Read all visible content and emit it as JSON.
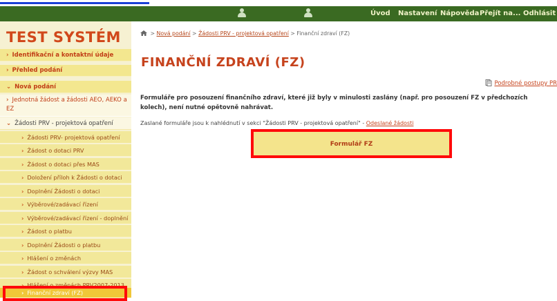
{
  "topnav": {
    "items": [
      "Úvod",
      "Nastavení",
      "Nápověda",
      "Přejít na...",
      "Odhlásit"
    ]
  },
  "sidebar": {
    "site_title": "TEST SYSTÉM",
    "items": [
      {
        "label": "Identifikační a kontaktní údaje"
      },
      {
        "label": "Přehled podání"
      },
      {
        "label": "Nová podání"
      },
      {
        "label": "Jednotná žádost a žádosti AEO, AEKO a EZ"
      },
      {
        "label": "Žádosti PRV - projektová opatření"
      },
      {
        "label": "Žádosti PRV- projektová opatření"
      },
      {
        "label": "Žádost o dotaci PRV"
      },
      {
        "label": "Žádost o dotaci přes MAS"
      },
      {
        "label": "Doložení příloh k Žádosti o dotaci"
      },
      {
        "label": "Doplnění Žádosti o dotaci"
      },
      {
        "label": "Výběrové/zadávací řízení"
      },
      {
        "label": "Výběrové/zadávací řízení - doplnění"
      },
      {
        "label": "Žádost o platbu"
      },
      {
        "label": "Doplnění Žádosti o platbu"
      },
      {
        "label": "Hlášení o změnách"
      },
      {
        "label": "Žádost o schválení výzvy MAS"
      },
      {
        "label": "Hlášení o změnách PRV2007-2013"
      },
      {
        "label": "Finanční zdraví (FZ)"
      }
    ]
  },
  "breadcrumb": {
    "sep": ">",
    "item1": "Nová podání",
    "item2": "Žádosti PRV - projektová opatření",
    "current": "Finanční zdraví (FZ)"
  },
  "main": {
    "title": "FINANČNÍ ZDRAVÍ (FZ)",
    "procedures_link": "Podrobné postupy PR",
    "intro": "Formuláře pro posouzení finančního zdraví, které již byly v minulosti zaslány (např. pro posouzení FZ v předchozích kolech), není nutné opětovně nahrávat.",
    "sent_note": "Zaslané formuláře jsou k nahlédnutí v sekci \"Žádosti PRV - projektová opatření\" - ",
    "sent_link": "Odeslané žádosti",
    "button_label": "Formulář FZ"
  },
  "colors": {
    "topbar": "#3a6a22",
    "title": "#c6431d",
    "sidebar_bg": "#f6f1d2",
    "highlight": "#ff0a0a",
    "button_bg": "#f4e48c",
    "active_item": "#f0c738"
  }
}
